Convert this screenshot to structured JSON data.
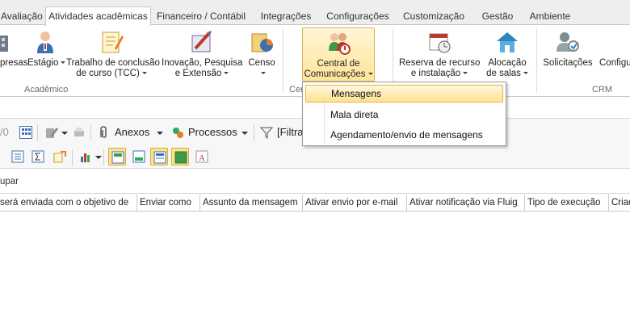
{
  "tabs": [
    {
      "label": "Avaliação",
      "active": false
    },
    {
      "label": "Atividades acadêmicas",
      "active": true
    },
    {
      "label": "Financeiro / Contábil",
      "active": false
    },
    {
      "label": "Integrações",
      "active": false
    },
    {
      "label": "Configurações",
      "active": false
    },
    {
      "label": "Customização",
      "active": false
    },
    {
      "label": "Gestão",
      "active": false
    },
    {
      "label": "Ambiente",
      "active": false
    }
  ],
  "ribbon": {
    "buttons": [
      {
        "line1": "presas",
        "line2": ""
      },
      {
        "line1": "Estágio",
        "line2": ""
      },
      {
        "line1": "Trabalho de conclusão",
        "line2": "de curso (TCC)"
      },
      {
        "line1": "Inovação, Pesquisa",
        "line2": "e Extensão"
      },
      {
        "line1": "Censo",
        "line2": ""
      },
      {
        "line1": "Central de",
        "line2": "Comunicações"
      },
      {
        "line1": "Reserva de recurso",
        "line2": "e instalação"
      },
      {
        "line1": "Alocação",
        "line2": "de salas"
      },
      {
        "line1": "Solicitações",
        "line2": ""
      },
      {
        "line1": "Configu",
        "line2": ""
      }
    ],
    "groups": {
      "academico": "Acadêmico",
      "central": "Cen",
      "crm": "CRM"
    }
  },
  "dropdown": {
    "items": [
      "Mensagens",
      "Mala direta",
      "Agendamento/envio de mensagens"
    ],
    "highlighted": "Mensagens"
  },
  "toolbar": {
    "record_count": "/0",
    "anexos": "Anexos",
    "processos": "Processos",
    "filtro": "[Filtra"
  },
  "group_panel_text": "upar",
  "grid": {
    "columns": [
      " será enviada com o objetivo de",
      "Enviar como",
      "Assunto da mensagem",
      "Ativar envio por e-mail",
      "Ativar notificação via Fluig",
      "Tipo de execução",
      "Criad"
    ]
  },
  "colors": {
    "accent": "#ffe391",
    "accent_border": "#d9b45b"
  },
  "icons": [
    "companies-icon",
    "intern-icon",
    "thesis-icon",
    "research-icon",
    "census-icon",
    "communication-center-icon",
    "resource-reservation-icon",
    "room-allocation-icon",
    "requests-icon"
  ]
}
